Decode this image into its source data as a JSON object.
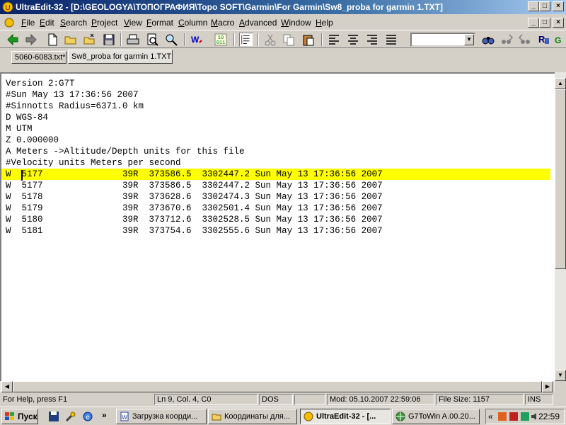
{
  "window": {
    "title": "UltraEdit-32 - [D:\\GEOLOGYA\\ТОПОГРАФИЯ\\Topo SOFT\\Garmin\\For Garmin\\Sw8_proba for garmin 1.TXT]",
    "min_label": "_",
    "max_label": "□",
    "close_label": "×"
  },
  "menu": {
    "items": [
      {
        "label": "File"
      },
      {
        "label": "Edit"
      },
      {
        "label": "Search"
      },
      {
        "label": "Project"
      },
      {
        "label": "View"
      },
      {
        "label": "Format"
      },
      {
        "label": "Column"
      },
      {
        "label": "Macro"
      },
      {
        "label": "Advanced"
      },
      {
        "label": "Window"
      },
      {
        "label": "Help"
      }
    ]
  },
  "tabs": [
    {
      "label": "5060-6083.txt*"
    },
    {
      "label": "Sw8_proba for garmin 1.TXT"
    }
  ],
  "editor": {
    "lines": [
      "Version 2:G7T",
      "#Sun May 13 17:36:56 2007",
      "#Sinnotts Radius=6371.0 km",
      "D WGS-84",
      "M UTM",
      "Z 0.000000",
      "A Meters ->Altitude/Depth units for this file",
      "#Velocity units Meters per second",
      "W  5177               39R  373586.5  3302447.2 Sun May 13 17:36:56 2007",
      "W  5177               39R  373586.5  3302447.2 Sun May 13 17:36:56 2007",
      "W  5178               39R  373628.6  3302474.3 Sun May 13 17:36:56 2007",
      "W  5179               39R  373670.6  3302501.4 Sun May 13 17:36:56 2007",
      "W  5180               39R  373712.6  3302528.5 Sun May 13 17:36:56 2007",
      "W  5181               39R  373754.6  3302555.6 Sun May 13 17:36:56 2007"
    ],
    "highlight_color": "#ffff00"
  },
  "status": {
    "help": "For Help, press F1",
    "position": "Ln 9, Col. 4, C0",
    "format": "DOS",
    "modified": "Mod: 05.10.2007 22:59:06",
    "filesize": "File Size: 1157",
    "mode": "INS"
  },
  "taskbar": {
    "start_label": "Пуск",
    "tasks": [
      {
        "label": "Загрузка коорди..."
      },
      {
        "label": "Координаты для..."
      },
      {
        "label": "UltraEdit-32 - [..."
      },
      {
        "label": "G7ToWin A.00.20..."
      }
    ],
    "more_label": "»",
    "tray_more_label": "«",
    "clock": "22:59"
  }
}
